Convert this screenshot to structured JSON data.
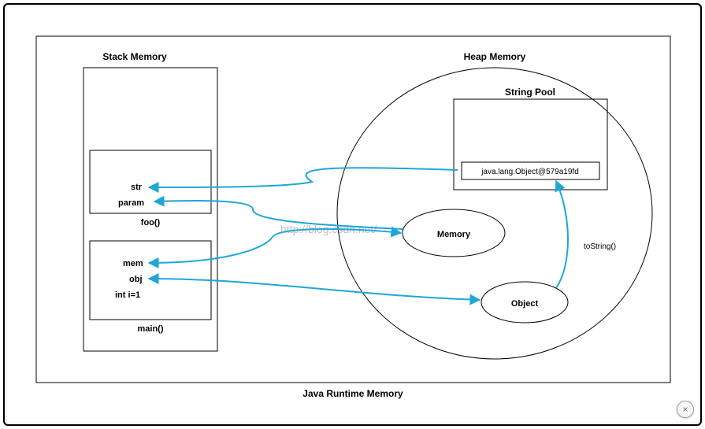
{
  "diagram": {
    "title": "Java Runtime Memory",
    "stack": {
      "title": "Stack Memory",
      "frames": {
        "foo": {
          "name": "foo()",
          "vars": [
            "str",
            "param"
          ]
        },
        "main": {
          "name": "main()",
          "vars": [
            "mem",
            "obj",
            "int i=1"
          ]
        }
      }
    },
    "heap": {
      "title": "Heap Memory",
      "string_pool": {
        "title": "String Pool",
        "entry": "java.lang.Object@579a19fd"
      },
      "memory_obj": "Memory",
      "object_obj": "Object",
      "toString_label": "toString()"
    },
    "watermark": "http://blog.csdn.net/"
  },
  "close_label": "×"
}
